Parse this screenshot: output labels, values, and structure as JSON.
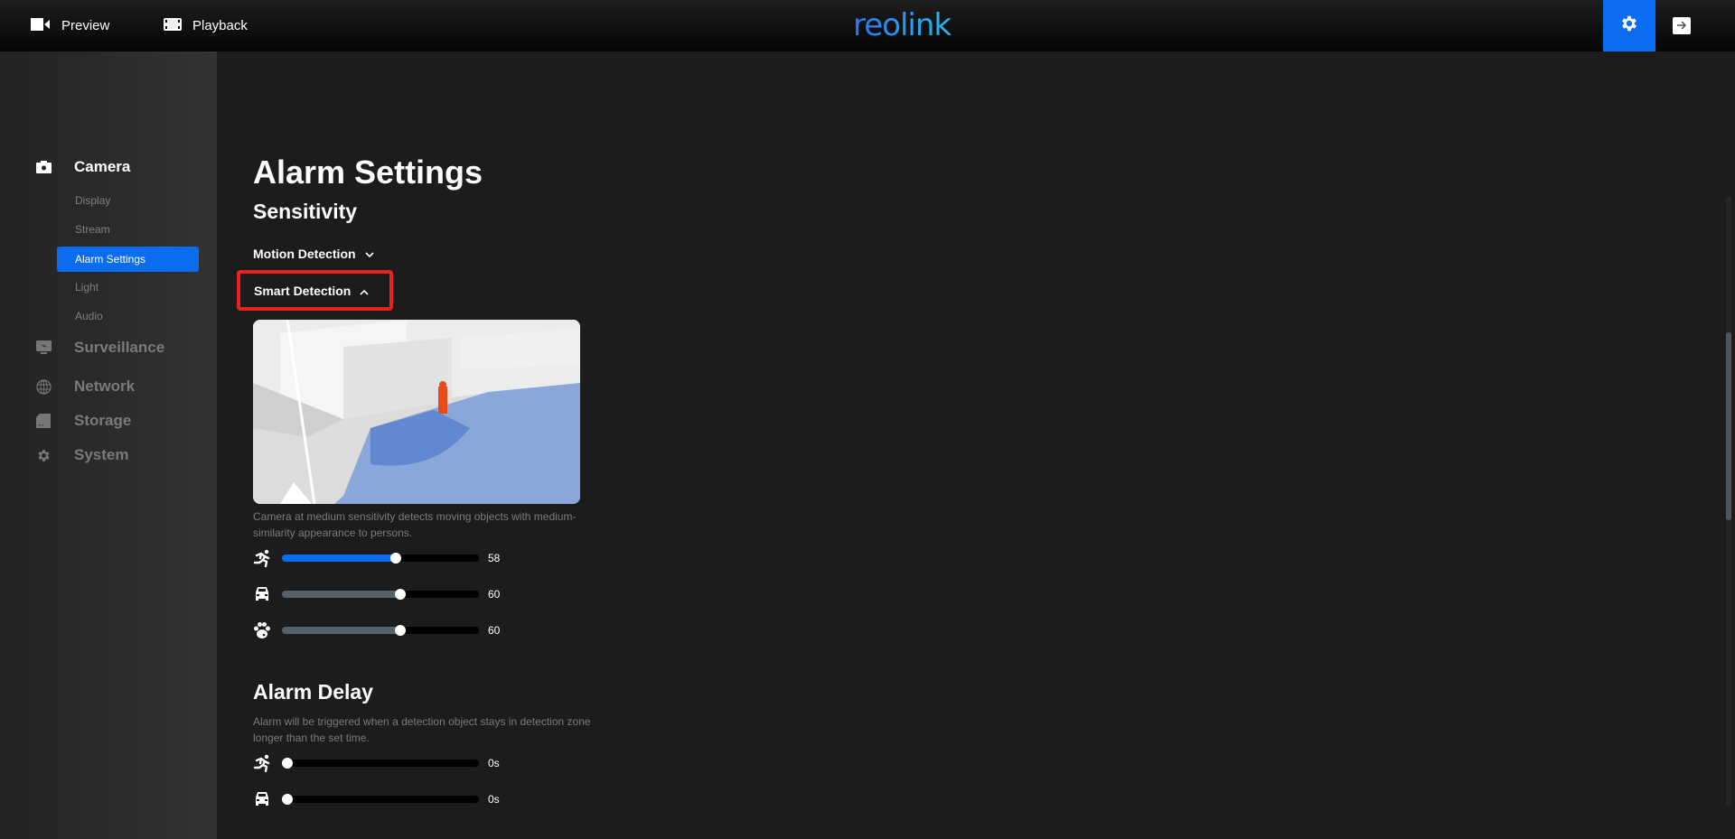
{
  "header": {
    "nav": [
      {
        "label": "Preview",
        "icon": "video-camera-icon"
      },
      {
        "label": "Playback",
        "icon": "film-icon"
      }
    ],
    "logo_text": "reolink",
    "settings_icon": "gear-icon",
    "logout_icon": "logout-arrow-icon",
    "accent_color": "#0a6cf0"
  },
  "sidebar": {
    "groups": [
      {
        "label": "Camera",
        "icon": "camera-icon",
        "active": true,
        "items": [
          {
            "label": "Display"
          },
          {
            "label": "Stream"
          },
          {
            "label": "Alarm Settings",
            "active": true
          },
          {
            "label": "Light"
          },
          {
            "label": "Audio"
          }
        ]
      },
      {
        "label": "Surveillance",
        "icon": "monitor-icon"
      },
      {
        "label": "Network",
        "icon": "globe-icon"
      },
      {
        "label": "Storage",
        "icon": "sd-card-icon"
      },
      {
        "label": "System",
        "icon": "gear-icon"
      }
    ]
  },
  "main": {
    "title": "Alarm Settings",
    "sensitivity": {
      "title": "Sensitivity",
      "motion_detection": {
        "label": "Motion Detection",
        "expanded": false
      },
      "smart_detection": {
        "label": "Smart Detection",
        "expanded": true
      },
      "description": "Camera at medium sensitivity detects moving objects with medium-similarity appearance to persons.",
      "sliders": [
        {
          "name": "person",
          "icon": "person-running-icon",
          "value": 58,
          "display": "58",
          "min": 0,
          "max": 100,
          "active": true
        },
        {
          "name": "vehicle",
          "icon": "car-icon",
          "value": 60,
          "display": "60",
          "min": 0,
          "max": 100,
          "active": false
        },
        {
          "name": "animal",
          "icon": "paw-icon",
          "value": 60,
          "display": "60",
          "min": 0,
          "max": 100,
          "active": false
        }
      ]
    },
    "alarm_delay": {
      "title": "Alarm Delay",
      "description": "Alarm will be triggered when a detection object stays in detection zone longer than the set time.",
      "sliders": [
        {
          "name": "person",
          "icon": "person-running-icon",
          "value": 0,
          "display": "0s"
        },
        {
          "name": "vehicle",
          "icon": "car-icon",
          "value": 0,
          "display": "0s"
        }
      ]
    }
  },
  "scroll": {
    "thumb_start_fraction": 0.223,
    "thumb_size_fraction": 0.308
  }
}
